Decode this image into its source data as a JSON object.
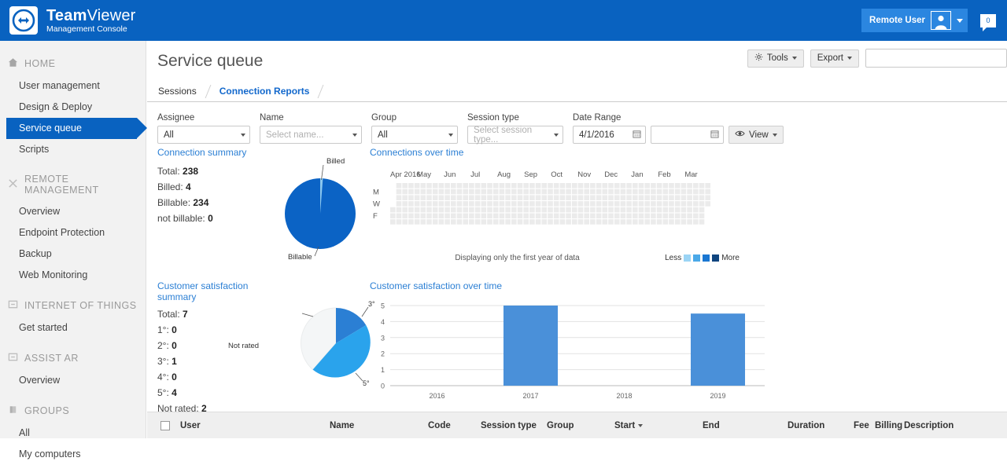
{
  "header": {
    "brand_bold": "Team",
    "brand_light": "Viewer",
    "brand_sub": "Management Console",
    "user_label": "Remote User",
    "chat_count": "0",
    "logo_icon": "arrows-icon",
    "avatar_icon": "avatar-icon",
    "chat_icon": "chat-bubble-icon",
    "brand_color": "#0962c0"
  },
  "sidebar": {
    "sections": [
      {
        "icon": "home-icon",
        "label": "HOME",
        "items": [
          "User management",
          "Design & Deploy",
          "Service queue",
          "Scripts"
        ],
        "active": "Service queue"
      },
      {
        "icon": "remote-management-icon",
        "label": "REMOTE MANAGEMENT",
        "items": [
          "Overview",
          "Endpoint Protection",
          "Backup",
          "Web Monitoring"
        ],
        "active": ""
      },
      {
        "icon": "iot-icon",
        "label": "INTERNET OF THINGS",
        "items": [
          "Get started"
        ],
        "active": ""
      },
      {
        "icon": "assist-ar-icon",
        "label": "ASSIST AR",
        "items": [
          "Overview"
        ],
        "active": ""
      },
      {
        "icon": "groups-icon",
        "label": "GROUPS",
        "items": [
          "All",
          "My computers"
        ],
        "active": ""
      }
    ]
  },
  "main": {
    "page_title": "Service queue",
    "toolbar": {
      "tools_label": "Tools",
      "tools_icon": "gear-icon",
      "export_label": "Export",
      "search_value": "",
      "search_placeholder": ""
    },
    "tabs": [
      {
        "label": "Sessions",
        "active": false
      },
      {
        "label": "Connection Reports",
        "active": true
      }
    ],
    "filters": [
      {
        "label": "Assignee",
        "value": "All",
        "placeholder": false,
        "width": 118
      },
      {
        "label": "Name",
        "value": "Select name...",
        "placeholder": true,
        "width": 130
      },
      {
        "label": "Group",
        "value": "All",
        "placeholder": false,
        "width": 110
      },
      {
        "label": "Session type",
        "value": "Select session type...",
        "placeholder": true,
        "width": 122
      }
    ],
    "date_range": {
      "label": "Date Range",
      "from": "4/1/2016",
      "to": "",
      "calendar_icon": "calendar-icon",
      "view_label": "View",
      "view_icon": "eye-icon"
    }
  },
  "connection_summary": {
    "title": "Connection summary",
    "rows": [
      {
        "label": "Total:",
        "value": "238"
      },
      {
        "label": "Billed:",
        "value": "4"
      },
      {
        "label": "Billable:",
        "value": "234"
      },
      {
        "label": "not billable:",
        "value": "0"
      }
    ],
    "pie_labels": {
      "top": "Billed",
      "bottom": "Billable"
    }
  },
  "satisfaction_summary": {
    "title_line1": "Customer satisfaction",
    "title_line2": "summary",
    "rows": [
      {
        "label": "Total:",
        "value": "7"
      },
      {
        "label": "1°:",
        "value": "0"
      },
      {
        "label": "2°:",
        "value": "0"
      },
      {
        "label": "3°:",
        "value": "1"
      },
      {
        "label": "4°:",
        "value": "0"
      },
      {
        "label": "5°:",
        "value": "4"
      },
      {
        "label": "Not rated:",
        "value": "2"
      }
    ],
    "pie_labels": {
      "not_rated": "Not rated",
      "three": "3°",
      "five": "5°"
    }
  },
  "heatmap": {
    "title": "Connections over time",
    "months": [
      "Apr 2016",
      "May",
      "Jun",
      "Jul",
      "Aug",
      "Sep",
      "Oct",
      "Nov",
      "Dec",
      "Jan",
      "Feb",
      "Mar"
    ],
    "days": [
      "M",
      "W",
      "F"
    ],
    "note": "Displaying only the first year of data",
    "legend_less": "Less",
    "legend_more": "More",
    "legend_colors": [
      "#9bd4f5",
      "#4ba9e8",
      "#1a77d2",
      "#10457f"
    ],
    "empty_color": "#ebebeb"
  },
  "chart_data": {
    "type": "bar",
    "title": "Customer satisfaction over time",
    "categories": [
      "2016",
      "2017",
      "2018",
      "2019"
    ],
    "values": [
      0,
      5,
      0,
      4.5
    ],
    "xlabel": "",
    "ylabel": "",
    "ylim": [
      0,
      5
    ],
    "yticks": [
      "0",
      "1",
      "2",
      "3",
      "4",
      "5"
    ],
    "grid": true,
    "legend": "none",
    "bar_color": "#4a90d9"
  },
  "pie_connection": {
    "type": "pie",
    "labels": [
      "Billable",
      "Billed"
    ],
    "values": [
      234,
      4
    ],
    "colors": [
      "#0b63c5",
      "#8cc8ef"
    ]
  },
  "pie_satisfaction": {
    "type": "pie",
    "labels": [
      "3°",
      "5°",
      "Not rated"
    ],
    "values": [
      1,
      4,
      2
    ],
    "colors": [
      "#2b7fd4",
      "#2aa3ec",
      "#f4f6f7"
    ]
  },
  "table": {
    "select_all_checkbox": "unchecked",
    "columns": [
      {
        "label": "User",
        "left": 42
      },
      {
        "label": "Name",
        "left": 232
      },
      {
        "label": "Code",
        "left": 357
      },
      {
        "label": "Session type",
        "left": 424
      },
      {
        "label": "Group",
        "left": 508
      },
      {
        "label": "Start",
        "left": 594,
        "sorted": true,
        "sort_icon": "sort-desc-icon"
      },
      {
        "label": "End",
        "left": 706
      },
      {
        "label": "Duration",
        "left": 814
      },
      {
        "label": "Fee",
        "left": 898
      },
      {
        "label": "Billing",
        "left": 925
      },
      {
        "label": "Description",
        "left": 962
      }
    ]
  }
}
